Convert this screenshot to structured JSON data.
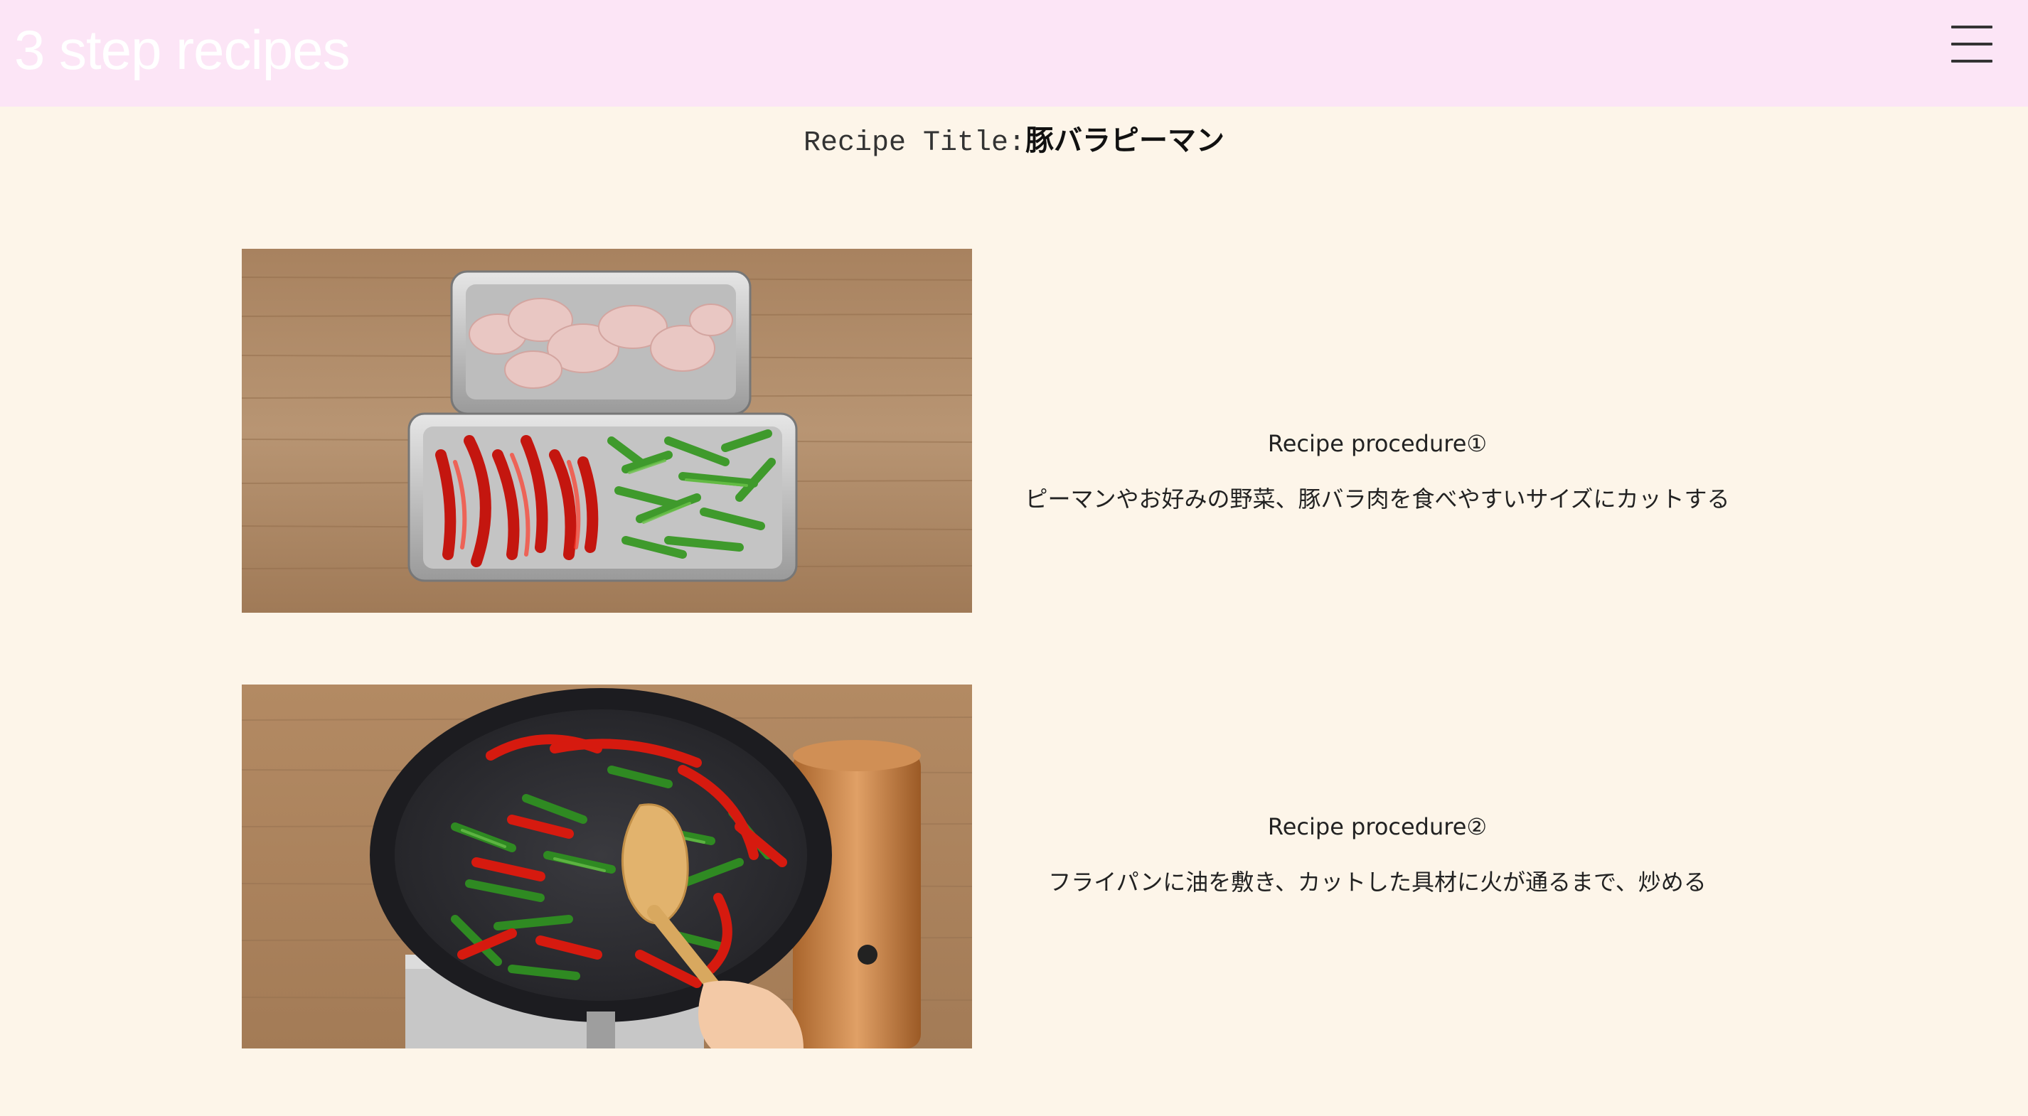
{
  "header": {
    "site_title": "3 step recipes",
    "menu_icon": "hamburger-menu-icon"
  },
  "recipe": {
    "title_label": "Recipe Title:",
    "title_name": "豚バラピーマン"
  },
  "steps": [
    {
      "heading": "Recipe procedure①",
      "description": "ピーマンやお好みの野菜、豚バラ肉を食べやすいサイズにカットする"
    },
    {
      "heading": "Recipe procedure②",
      "description": "フライパンに油を敷き、カットした具材に火が通るまで、炒める"
    }
  ],
  "colors": {
    "header_bg": "#fce5f6",
    "page_bg": "#fdf5e9",
    "title_text": "#ffffff"
  }
}
